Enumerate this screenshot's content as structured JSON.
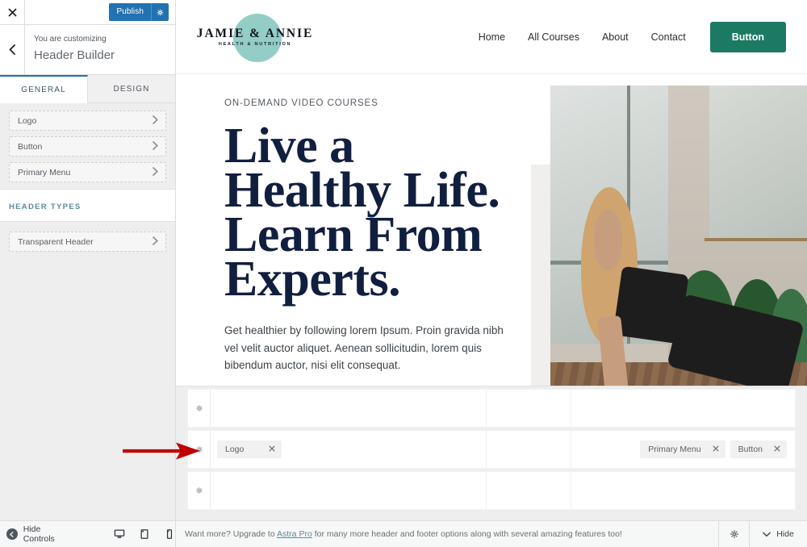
{
  "customizer": {
    "close_icon": "close-icon",
    "publish_label": "Publish",
    "publish_gear_icon": "gear-icon",
    "back_icon": "chevron-left-icon",
    "subtitle": "You are customizing",
    "title": "Header Builder",
    "tabs": [
      {
        "label": "GENERAL",
        "active": true
      },
      {
        "label": "DESIGN",
        "active": false
      }
    ],
    "accordion_items": [
      {
        "label": "Logo",
        "chevron": "chevron-right-icon"
      },
      {
        "label": "Button",
        "chevron": "chevron-right-icon"
      },
      {
        "label": "Primary Menu",
        "chevron": "chevron-right-icon"
      }
    ],
    "section_header": "HEADER TYPES",
    "header_type_items": [
      {
        "label": "Transparent Header",
        "chevron": "chevron-right-icon"
      }
    ]
  },
  "site": {
    "logo": {
      "name": "JAMIE & ANNIE",
      "tagline": "HEALTH & NUTRITION",
      "circle_color": "#93cdc6"
    },
    "nav": [
      {
        "label": "Home"
      },
      {
        "label": "All Courses"
      },
      {
        "label": "About"
      },
      {
        "label": "Contact"
      }
    ],
    "header_button": {
      "label": "Button",
      "color": "#1c7a63"
    },
    "hero": {
      "eyebrow": "ON-DEMAND VIDEO COURSES",
      "heading": "Live a Healthy Life. Learn From Experts.",
      "heading_color": "#111f3f",
      "paragraph": "Get healthier by following lorem Ipsum. Proin gravida nibh vel velit auctor aliquet. Aenean sollicitudin, lorem quis bibendum auctor, nisi elit consequat.",
      "cta_color": "#1c7a63",
      "image_alt": "woman-doing-yoga-plank-pose-in-plant-filled-studio"
    }
  },
  "builder": {
    "rows": [
      {
        "gear_icon": "gear-icon",
        "col1_items": [],
        "col2_items": [],
        "col3_items": []
      },
      {
        "gear_icon": "gear-icon",
        "col1_items": [
          {
            "label": "Logo",
            "remove_icon": "close-icon"
          }
        ],
        "col2_items": [],
        "col3_items": [
          {
            "label": "Primary Menu",
            "remove_icon": "close-icon"
          },
          {
            "label": "Button",
            "remove_icon": "close-icon"
          }
        ]
      },
      {
        "gear_icon": "gear-icon",
        "col1_items": [],
        "col2_items": [],
        "col3_items": []
      }
    ]
  },
  "bottom_bar": {
    "hide_controls_label": "Hide Controls",
    "hide_controls_icon": "collapse-circle-icon",
    "devices": [
      {
        "name": "desktop-icon",
        "active": true
      },
      {
        "name": "tablet-icon",
        "active": false
      },
      {
        "name": "mobile-icon",
        "active": false
      }
    ],
    "promo_prefix": "Want more? Upgrade to ",
    "promo_link": "Astra Pro",
    "promo_suffix": " for many more header and footer options along with several amazing features too!",
    "gear_icon": "gear-icon",
    "hide_label": "Hide",
    "hide_chevron": "chevron-down-icon"
  },
  "annotation": {
    "arrow_color": "#c00000",
    "points_to": "builder-row-2-logo-chip"
  }
}
